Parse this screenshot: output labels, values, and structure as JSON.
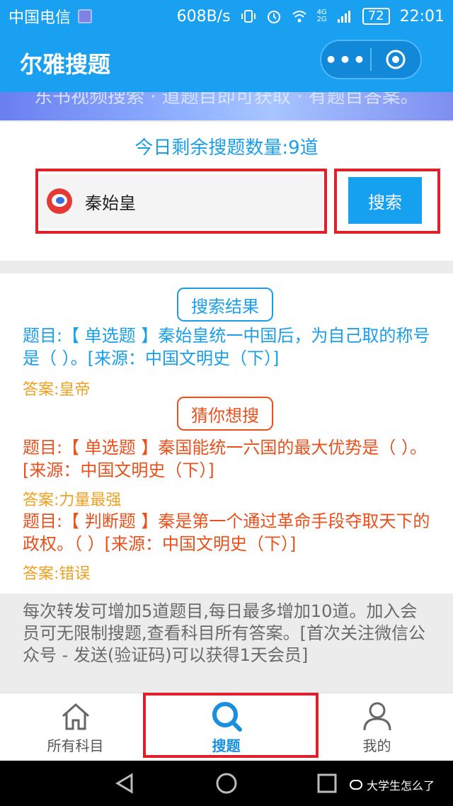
{
  "status_bar": {
    "carrier": "中国电信",
    "speed": "608B/s",
    "net_4g": "4G",
    "net_2g": "2G",
    "battery": "72",
    "time": "22:01"
  },
  "nav": {
    "title": "尔雅搜题",
    "more_glyph": "•••"
  },
  "banner": {
    "text": "东书视频搜索 · 道题目即可获取 · 有题目答案。"
  },
  "search": {
    "remaining_text": "今日剩余搜题数量:9道",
    "value": "秦始皇",
    "button_label": "搜索"
  },
  "results": {
    "section_label": "搜索结果",
    "main": {
      "question": "题目:【 单选题 】秦始皇统一中国后，为自己取的称号是（ ）。[来源：中国文明史（下）]",
      "answer": "答案:皇帝"
    },
    "suggest_label": "猜你想搜",
    "suggestions": [
      {
        "question": "题目:【 单选题 】秦国能统一六国的最大优势是（ ）。[来源：中国文明史（下）]",
        "answer": "答案:力量最强"
      },
      {
        "question": "题目:【 判断题 】秦是第一个通过革命手段夺取天下的政权。（ ）[来源：中国文明史（下）]",
        "answer": "答案:错误"
      }
    ]
  },
  "footnote": "每次转发可增加5道题目,每日最多增加10道。加入会员可无限制搜题,查看科目所有答案。[首次关注微信公众号 - 发送(验证码)可以获得1天会员]",
  "tabbar": {
    "tabs": [
      {
        "label": "所有科目",
        "icon": "home-icon"
      },
      {
        "label": "搜题",
        "icon": "search-icon",
        "active": true
      },
      {
        "label": "我的",
        "icon": "user-icon"
      }
    ]
  },
  "watermark": "大学生怎么了",
  "colors": {
    "primary": "#1aa0f0",
    "result_blue": "#1a9ee8",
    "suggest_red": "#e8501c",
    "answer_orange": "#f0a020",
    "highlight": "#e0202a"
  }
}
